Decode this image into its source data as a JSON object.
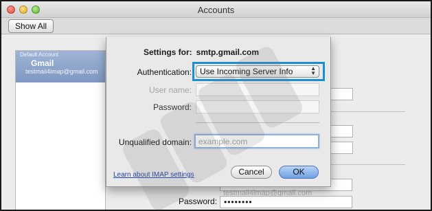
{
  "window": {
    "title": "Accounts"
  },
  "toolbar": {
    "show_all_label": "Show All"
  },
  "sidebar": {
    "section_label": "Default Account",
    "account_name": "Gmail",
    "account_email": "testmail4imap@gmail.com"
  },
  "background": {
    "ghost_username": "User name: testmail4imap@gmail.com",
    "password_label": "Password:",
    "password_value": "••••••••"
  },
  "sheet": {
    "settings_for_label": "Settings for:",
    "server": "smtp.gmail.com",
    "authentication_label": "Authentication:",
    "authentication_value": "Use Incoming Server Info",
    "username_label": "User name:",
    "password_label": "Password:",
    "unqualified_domain_label": "Unqualified domain:",
    "unqualified_domain_placeholder": "example.com",
    "learn_link": "Learn about IMAP settings",
    "cancel_label": "Cancel",
    "ok_label": "OK"
  },
  "colors": {
    "highlight": "#1d8fd0",
    "selection": "#8aa2cb",
    "link": "#1f3fae"
  }
}
